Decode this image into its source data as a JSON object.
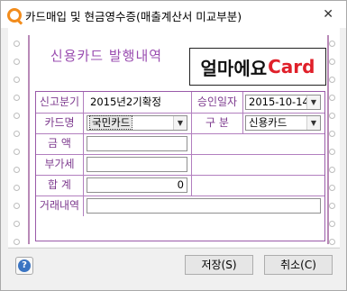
{
  "window": {
    "title": "카드매입 및 현금영수증(매출계산서 미교부분)",
    "close_glyph": "✕"
  },
  "receipt": {
    "title": "신용카드 발행내역",
    "brand": {
      "part1": "얼마에요",
      "part2": "Card"
    }
  },
  "form": {
    "report_period_label": "신고분기",
    "report_period_value": "2015년2기확정",
    "approval_date_label": "승인일자",
    "approval_date_value": "2015-10-14",
    "card_name_label": "카드명",
    "card_name_value": "국민카드",
    "type_label": "구    분",
    "type_value": "신용카드",
    "amount_label": "금    액",
    "amount_value": "",
    "vat_label": "부가세",
    "vat_value": "",
    "total_label": "합    계",
    "total_value": "0",
    "transaction_label": "거래내역",
    "transaction_value": ""
  },
  "footer": {
    "help_glyph": "?",
    "save_label": "저장(S)",
    "cancel_label": "취소(C)"
  },
  "colors": {
    "accent": "#9a4db0",
    "brand_red": "#e0202a",
    "border": "#b27fbf"
  }
}
